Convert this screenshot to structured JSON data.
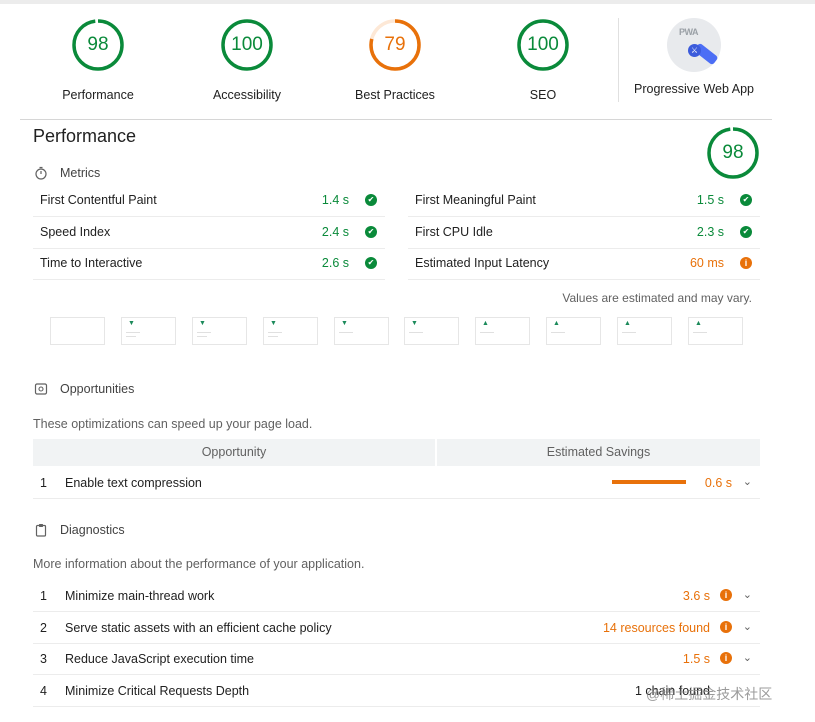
{
  "categories": [
    {
      "score": "98",
      "label": "Performance",
      "color": "#0a8a3a",
      "fraction": 0.98
    },
    {
      "score": "100",
      "label": "Accessibility",
      "color": "#0a8a3a",
      "fraction": 1.0
    },
    {
      "score": "79",
      "label": "Best Practices",
      "color": "#e8710a",
      "fraction": 0.79
    },
    {
      "score": "100",
      "label": "SEO",
      "color": "#0a8a3a",
      "fraction": 1.0
    }
  ],
  "pwa": {
    "badge_text": "PWA",
    "label": "Progressive Web App"
  },
  "performance": {
    "title": "Performance",
    "score": "98",
    "metrics_heading": "Metrics",
    "metrics": [
      {
        "label": "First Contentful Paint",
        "value": "1.4 s",
        "status": "pass"
      },
      {
        "label": "First Meaningful Paint",
        "value": "1.5 s",
        "status": "pass"
      },
      {
        "label": "Speed Index",
        "value": "2.4 s",
        "status": "pass"
      },
      {
        "label": "First CPU Idle",
        "value": "2.3 s",
        "status": "pass"
      },
      {
        "label": "Time to Interactive",
        "value": "2.6 s",
        "status": "pass"
      },
      {
        "label": "Estimated Input Latency",
        "value": "60 ms",
        "status": "average"
      }
    ],
    "estimate_note": "Values are estimated and may vary.",
    "opportunities_heading": "Opportunities",
    "opportunities_desc": "These optimizations can speed up your page load.",
    "opportunity_col": "Opportunity",
    "savings_col": "Estimated Savings",
    "opportunities": [
      {
        "index": "1",
        "label": "Enable text compression",
        "savings": "0.6 s"
      }
    ],
    "diagnostics_heading": "Diagnostics",
    "diagnostics_desc": "More information about the performance of your application.",
    "diagnostics": [
      {
        "index": "1",
        "label": "Minimize main-thread work",
        "value": "3.6 s"
      },
      {
        "index": "2",
        "label": "Serve static assets with an efficient cache policy",
        "value": "14 resources found"
      },
      {
        "index": "3",
        "label": "Reduce JavaScript execution time",
        "value": "1.5 s"
      },
      {
        "index": "4",
        "label": "Minimize Critical Requests Depth",
        "value": "1 chain found"
      }
    ]
  },
  "watermark": "@稀土掘金技术社区",
  "icons": {
    "pass": "check-circle-icon",
    "average": "info-circle-icon",
    "expand": "chevron-down-icon"
  }
}
